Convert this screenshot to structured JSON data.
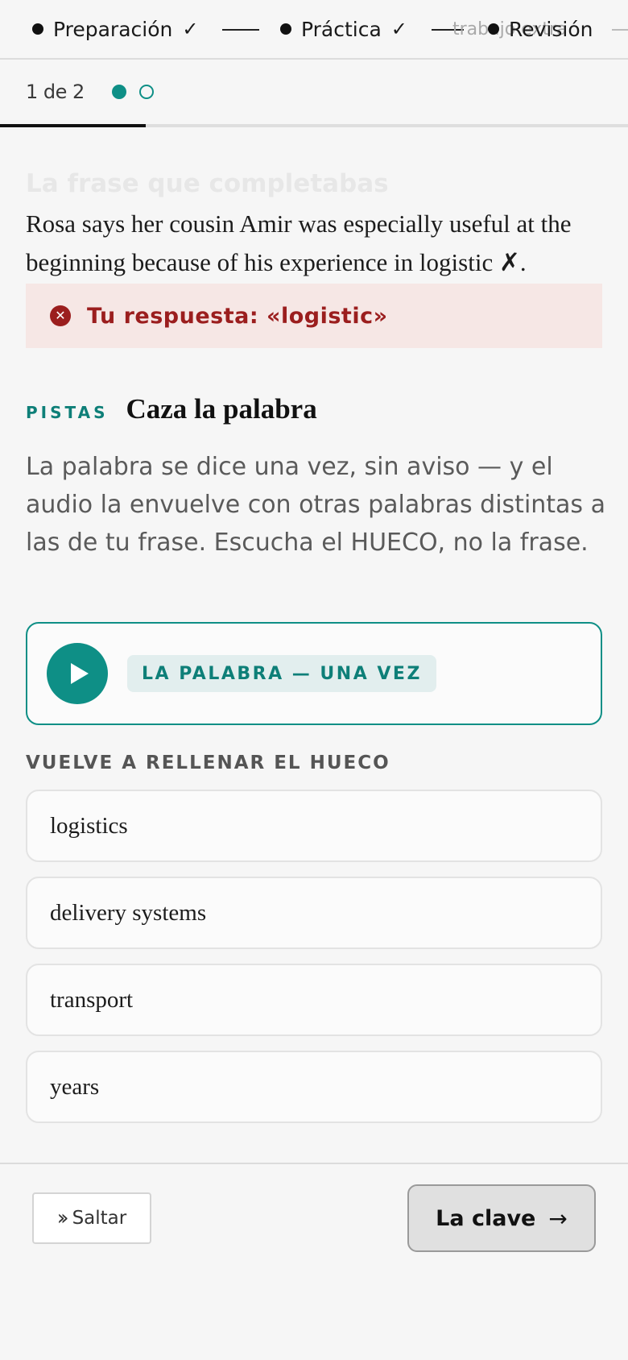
{
  "stepper": {
    "steps": [
      {
        "label": "Preparación",
        "done_mark": "✓"
      },
      {
        "label": "Práctica",
        "done_mark": "✓"
      },
      {
        "label": "Revisión"
      }
    ],
    "overlap_label": "trabajo extra"
  },
  "progress": {
    "counter": "1 de 2",
    "current": 1,
    "total": 2,
    "fill_fraction": 0.5
  },
  "question": {
    "faded_title": "La frase que completabas",
    "sentence": "Rosa says her cousin Amir was especially useful at the beginning because of his experience in logistic ✗.",
    "answer_icon": "x-circle-icon",
    "answer_text": "Tu respuesta: «logistic»"
  },
  "hints": {
    "tag": "PISTAS",
    "title": "Caza la palabra",
    "body": "La palabra se dice una vez, sin aviso — y el audio la envuelve con otras palabras distintas a las de tu frase. Escucha el HUECO, no la frase."
  },
  "audio": {
    "play_icon": "play-icon",
    "label": "LA PALABRA — UNA VEZ"
  },
  "refill": {
    "label": "VUELVE A RELLENAR EL HUECO",
    "options": [
      "logistics",
      "delivery systems",
      "transport",
      "years"
    ]
  },
  "footer": {
    "skip_label": "Saltar",
    "skip_icon": "double-chevron-right-icon",
    "key_label": "La clave",
    "key_icon": "arrow-right-icon"
  },
  "colors": {
    "accent": "#0e8f86",
    "error": "#9b1e1e",
    "error_bg": "#f6e7e5"
  }
}
